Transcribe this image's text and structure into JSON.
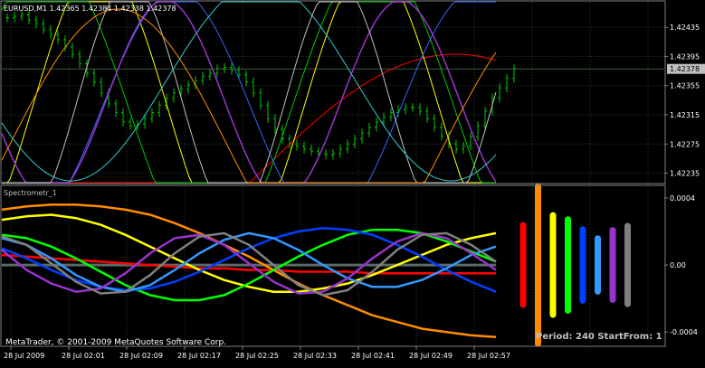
{
  "main_chart": {
    "title": "EURUSD,M1  1.42365 1.42384 1.42338 1.42378",
    "price_labels": [
      "1.42435",
      "1.42395",
      "1.42355",
      "1.42315",
      "1.42275",
      "1.42235"
    ],
    "price_values": [
      1.42435,
      1.42395,
      1.42355,
      1.42315,
      1.42275,
      1.42235
    ],
    "current_price": "1.42378",
    "current_price_value": 1.42378,
    "ylim": [
      1.42222,
      1.4247
    ]
  },
  "indicator": {
    "title": "Spectrometr_1",
    "labels": [
      "0.0004",
      "0.00",
      "-0.0004"
    ],
    "label_values": [
      0.0004,
      0.0,
      -0.0004
    ],
    "ylim": [
      -0.00048,
      0.00047
    ],
    "status_text": "Period: 240 StartFrom: 1",
    "status_color": "#c0c0c0"
  },
  "time_axis": {
    "labels": [
      "28 Jul 2009",
      "28 Jul 02:01",
      "28 Jul 02:09",
      "28 Jul 02:17",
      "28 Jul 02:25",
      "28 Jul 02:33",
      "28 Jul 02:41",
      "28 Jul 02:49",
      "28 Jul 02:57"
    ]
  },
  "copyright": "MetaTrader, © 2001-2009 MetaQuotes Software Corp.",
  "colors": {
    "background": "#000000",
    "grid": "#2a3a2a",
    "frame": "#808080",
    "candle": "#00c800",
    "price_line": "#3c5a3c",
    "spectrum": [
      "#ff0000",
      "#ff8c00",
      "#ffff00",
      "#00ff00",
      "#0040ff",
      "#3399ff",
      "#9933cc",
      "#808080"
    ]
  },
  "chart_data": [
    {
      "type": "line",
      "title": "EURUSD,M1  1.42365 1.42384 1.42338 1.42378",
      "description_series": "candles",
      "series": [
        {
          "values": [
            1.42448,
            1.4245,
            1.42452,
            1.42445,
            1.4244,
            1.42432,
            1.42425,
            1.42418,
            1.42408,
            1.42398,
            1.42385,
            1.42372,
            1.4236,
            1.42345,
            1.4233,
            1.42318,
            1.42305,
            1.423,
            1.42302,
            1.4231,
            1.42318,
            1.42328,
            1.42338,
            1.42345,
            1.4235,
            1.42356,
            1.42362,
            1.42368,
            1.42372,
            1.42378,
            1.4238,
            1.42376,
            1.4237,
            1.4236,
            1.42345,
            1.42328,
            1.4231,
            1.42295,
            1.42282,
            1.42275,
            1.42272,
            1.42268,
            1.42265,
            1.42262,
            1.4226,
            1.42262,
            1.42268,
            1.42275,
            1.42282,
            1.4229,
            1.42298,
            1.42305,
            1.42312,
            1.42318,
            1.42322,
            1.42325,
            1.42325,
            1.4232,
            1.4231,
            1.42298,
            1.42286,
            1.42275,
            1.42268,
            1.42272,
            1.42285,
            1.423,
            1.4232,
            1.42338,
            1.42352,
            1.42365,
            1.42378
          ]
        }
      ]
    },
    {
      "type": "line",
      "title": "Spectrometr_1",
      "ylim": [
        -0.00048,
        0.00047
      ],
      "series": [
        {
          "values": [
            6e-05,
            5e-05,
            4e-05,
            3e-05,
            2e-05,
            1e-05,
            0.0,
            -1e-05,
            -2e-05,
            -2e-05,
            -3e-05,
            -3e-05,
            -4e-05,
            -4e-05,
            -4e-05,
            -5e-05,
            -5e-05,
            -5e-05,
            -5e-05,
            -5e-05,
            -5e-05
          ]
        },
        {
          "values": [
            0.00033,
            0.00035,
            0.00036,
            0.00036,
            0.00035,
            0.00033,
            0.0003,
            0.00025,
            0.00019,
            0.00012,
            5e-05,
            -3e-05,
            -0.00011,
            -0.00018,
            -0.00024,
            -0.0003,
            -0.00034,
            -0.00038,
            -0.0004,
            -0.00042,
            -0.00043
          ]
        },
        {
          "values": [
            0.00027,
            0.00029,
            0.0003,
            0.00028,
            0.00024,
            0.00018,
            0.00011,
            4e-05,
            -3e-05,
            -9e-05,
            -0.00013,
            -0.00016,
            -0.00016,
            -0.00014,
            -0.00011,
            -6e-05,
            0.0,
            6e-05,
            0.00012,
            0.00016,
            0.00019
          ]
        },
        {
          "values": [
            0.00018,
            0.00016,
            0.00011,
            4e-05,
            -4e-05,
            -0.00012,
            -0.00018,
            -0.00021,
            -0.00021,
            -0.00018,
            -0.00011,
            -3e-05,
            5e-05,
            0.00012,
            0.00018,
            0.00021,
            0.00021,
            0.00019,
            0.00014,
            8e-05,
            2e-05
          ]
        },
        {
          "values": [
            0.0001,
            4e-05,
            -3e-05,
            -9e-05,
            -0.00013,
            -0.00015,
            -0.00014,
            -0.0001,
            -4e-05,
            3e-05,
            0.0001,
            0.00016,
            0.0002,
            0.00022,
            0.00021,
            0.00018,
            0.00012,
            5e-05,
            -3e-05,
            -0.0001,
            -0.00016
          ]
        },
        {
          "values": [
            0.00016,
            0.00012,
            4e-05,
            -6e-05,
            -0.00013,
            -0.00016,
            -0.00012,
            -3e-05,
            7e-05,
            0.00015,
            0.00019,
            0.00016,
            9e-05,
            0.0,
            -8e-05,
            -0.00013,
            -0.00013,
            -9e-05,
            -2e-05,
            6e-05,
            0.00011
          ]
        },
        {
          "values": [
            9e-05,
            -3e-05,
            -0.00011,
            -0.00016,
            -0.00014,
            -5e-05,
            7e-05,
            0.00016,
            0.00018,
            0.00012,
            1e-05,
            -0.0001,
            -0.00017,
            -0.00016,
            -8e-05,
            4e-05,
            0.00014,
            0.00019,
            0.00016,
            7e-05,
            -3e-05
          ]
        },
        {
          "values": [
            0.00017,
            0.00012,
            1e-05,
            -0.0001,
            -0.00017,
            -0.00016,
            -6e-05,
            7e-05,
            0.00017,
            0.00019,
            0.00012,
            0.0,
            -0.00012,
            -0.00018,
            -0.00015,
            -4e-05,
            9e-05,
            0.00018,
            0.00019,
            0.00012,
            2e-05
          ]
        }
      ]
    },
    {
      "type": "bar",
      "title": "",
      "values": [
        0.00048,
        0.00095,
        0.0006,
        0.00055,
        0.00043,
        0.00032,
        0.00042,
        0.00047
      ]
    }
  ]
}
